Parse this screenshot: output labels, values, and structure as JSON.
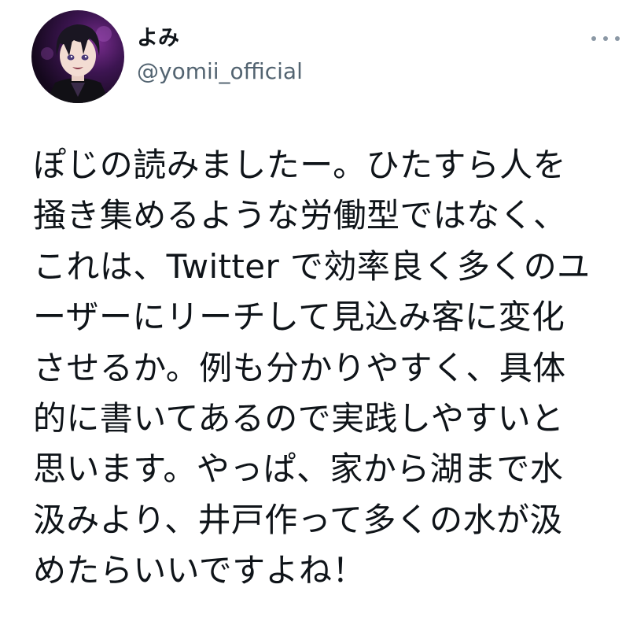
{
  "tweet": {
    "author": {
      "display_name": "よみ",
      "handle": "@yomii_official",
      "avatar_icon": "profile-avatar-illustration"
    },
    "more_icon": "more-dots-icon",
    "text_lines": [
      "ぽじの読みましたー。ひたすら人を",
      "掻き集めるような労働型ではなく、",
      "これは、Twitter で効率良く多くのユ",
      "ーザーにリーチして見込み客に変化",
      "させるか。例も分かりやすく、具体",
      "的に書いてあるので実践しやすいと",
      "思います。やっぱ、家から湖まで水",
      "汲みより、井戸作って多くの水が汲",
      "めたらいいですよね！"
    ]
  },
  "colors": {
    "text_primary": "#0f1419",
    "text_secondary": "#536471",
    "background": "#ffffff"
  }
}
